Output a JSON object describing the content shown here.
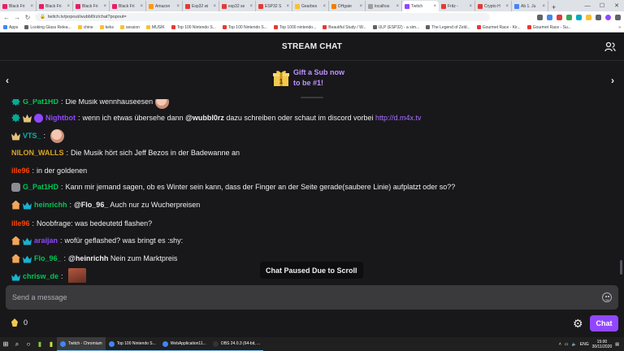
{
  "browser": {
    "tabs": [
      {
        "label": "Black Fri",
        "color": "#e91e63"
      },
      {
        "label": "Black Fri",
        "color": "#e91e63"
      },
      {
        "label": "Black Fri",
        "color": "#e91e63"
      },
      {
        "label": "Black Fri",
        "color": "#e91e63"
      },
      {
        "label": "Amazon",
        "color": "#ff9900"
      },
      {
        "label": "Esp32 wi",
        "color": "#e53935"
      },
      {
        "label": "esp32 se",
        "color": "#e53935"
      },
      {
        "label": "ESP32 S",
        "color": "#e53935"
      },
      {
        "label": "Gearbes",
        "color": "#fbc02d"
      },
      {
        "label": "DHgate",
        "color": "#f57c00"
      },
      {
        "label": "localhos",
        "color": "#9e9e9e"
      },
      {
        "label": "Twitch",
        "color": "#9147ff",
        "active": true
      },
      {
        "label": "Fritz - ",
        "color": "#e53935"
      },
      {
        "label": "Crypto H",
        "color": "#e53935"
      },
      {
        "label": "Ab 1. Ju",
        "color": "#4285f4"
      }
    ],
    "url": "twitch.tv/popout/wubbl0rz/chat?popout=",
    "bookmarks": [
      {
        "label": "Apps",
        "color": "#4285f4"
      },
      {
        "label": "Looking Glass Relea...",
        "color": "#616161"
      },
      {
        "label": "chine",
        "color": "#fbc02d"
      },
      {
        "label": "keks",
        "color": "#fbc02d"
      },
      {
        "label": "session",
        "color": "#fbc02d"
      },
      {
        "label": "MUSIK",
        "color": "#fbc02d"
      },
      {
        "label": "Top 100 Nintendo S...",
        "color": "#e53935"
      },
      {
        "label": "Top 100 Nintendo S...",
        "color": "#e53935"
      },
      {
        "label": "Top 1000 nintendo...",
        "color": "#e53935"
      },
      {
        "label": "Beautiful Study / W...",
        "color": "#e53935"
      },
      {
        "label": "ULP (ESP32) - a sim...",
        "color": "#616161"
      },
      {
        "label": "The Legend of Zeld...",
        "color": "#616161"
      },
      {
        "label": "Gourmet Race - Kir...",
        "color": "#e53935"
      },
      {
        "label": "Gourmet Race - Su...",
        "color": "#e53935"
      }
    ],
    "bookmarks_more": "»"
  },
  "chat": {
    "title": "STREAM CHAT",
    "gift_line1": "Gift a Sub now",
    "gift_line2": "to be #1!",
    "paused_label": "Chat Paused Due to Scroll",
    "input_placeholder": "Send a message",
    "points": "0",
    "chat_button": "Chat",
    "messages": [
      {
        "badges": [
          "cog"
        ],
        "user": "G_Pat1HD",
        "color": "#00c853",
        "text": "Die Musik wennhauseesen",
        "emote": true
      },
      {
        "badges": [
          "cog",
          "crown",
          "verify"
        ],
        "user": "Nightbot",
        "color": "#9147ff",
        "pre": "wenn ich etwas übersehe dann ",
        "mention": "@wubbl0rz",
        "post": " dazu schreiben oder schaut im discord vorbei ",
        "link": "http://d.m4x.tv"
      },
      {
        "badges": [
          "crown"
        ],
        "user": "VTS_",
        "color": "#00b5ad",
        "text": "",
        "emote": true
      },
      {
        "badges": [],
        "user": "NILON_WALLS",
        "color": "#daa520",
        "text": "Die Musik hört sich Jeff Bezos in der Badewanne an"
      },
      {
        "badges": [],
        "user": "ille96",
        "color": "#ff4500",
        "text": "in der goldenen"
      },
      {
        "badges": [
          "car"
        ],
        "user": "G_Pat1HD",
        "color": "#00c853",
        "text": "Kann mir jemand sagen, ob es Winter sein kann, dass der Finger an der Seite gerade(saubere Linie) aufplatzt oder so??"
      },
      {
        "badges": [
          "house",
          "sub"
        ],
        "user": "heinrichh",
        "color": "#00c853",
        "mention": "@Flo_96_",
        "post": " Auch nur zu Wucherpreisen"
      },
      {
        "badges": [],
        "user": "ille96",
        "color": "#ff4500",
        "text": "Noobfrage: was bedeutetd flashen?"
      },
      {
        "badges": [
          "house",
          "sub"
        ],
        "user": "araijan",
        "color": "#9147ff",
        "text": "wofür geflashed? was bringt es :shy:"
      },
      {
        "badges": [
          "house",
          "sub"
        ],
        "user": "Flo_96_",
        "color": "#00c853",
        "mention": "@heinrichh",
        "post": " Nein zum Marktpreis"
      },
      {
        "badges": [
          "sub"
        ],
        "user": "chrisw_de",
        "color": "#00c853",
        "text": "",
        "image_emote": true
      }
    ]
  },
  "taskbar": {
    "apps": [
      {
        "label": "Twitch - Chromium",
        "color": "#4285f4",
        "active": true
      },
      {
        "label": "Top 100 Nintendo S...",
        "color": "#4285f4"
      },
      {
        "label": "WebApplication11...",
        "color": "#4285f4"
      },
      {
        "label": "OBS 24.0.3 (64-bit, ...",
        "color": "#333333"
      }
    ],
    "lang": "ENG",
    "time": "15:00",
    "date": "30/11/2020"
  }
}
